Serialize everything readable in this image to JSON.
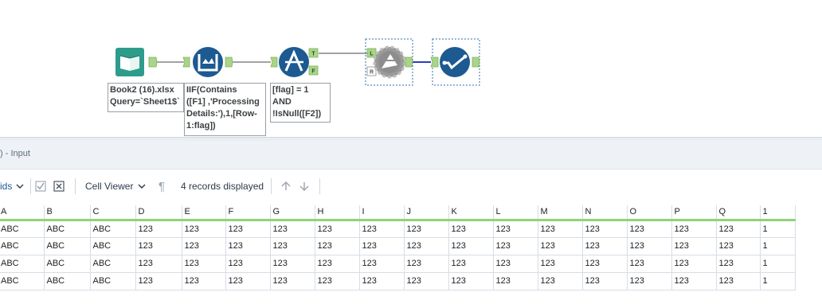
{
  "canvas": {
    "tools": [
      {
        "name": "input-data-tool",
        "annotation": "Book2 (16).xlsx\nQuery=`Sheet1$`"
      },
      {
        "name": "multi-row-formula-tool",
        "annotation": "IIF(Contains\n([F1] ,'Processing\nDetails:'),1,[Row-\n1:flag])"
      },
      {
        "name": "filter-tool",
        "annotation": "[flag] = 1\nAND\n!IsNull([F2])",
        "anchors": [
          "T",
          "F"
        ]
      },
      {
        "name": "dynamic-rename-tool",
        "anchors": [
          "L",
          "R"
        ]
      },
      {
        "name": "select-tool"
      }
    ]
  },
  "results": {
    "title": ") - Input",
    "toolbar": {
      "fields_label": "ids",
      "cell_viewer_label": "Cell Viewer",
      "records_label": "4 records displayed"
    },
    "columns": [
      "A",
      "B",
      "C",
      "D",
      "E",
      "F",
      "G",
      "H",
      "I",
      "J",
      "K",
      "L",
      "M",
      "N",
      "O",
      "P",
      "Q",
      "1"
    ],
    "rows": [
      [
        "ABC",
        "ABC",
        "ABC",
        "123",
        "123",
        "123",
        "123",
        "123",
        "123",
        "123",
        "123",
        "123",
        "123",
        "123",
        "123",
        "123",
        "123",
        "1"
      ],
      [
        "ABC",
        "ABC",
        "ABC",
        "123",
        "123",
        "123",
        "123",
        "123",
        "123",
        "123",
        "123",
        "123",
        "123",
        "123",
        "123",
        "123",
        "123",
        "1"
      ],
      [
        "ABC",
        "ABC",
        "ABC",
        "123",
        "123",
        "123",
        "123",
        "123",
        "123",
        "123",
        "123",
        "123",
        "123",
        "123",
        "123",
        "123",
        "123",
        "1"
      ],
      [
        "ABC",
        "ABC",
        "ABC",
        "123",
        "123",
        "123",
        "123",
        "123",
        "123",
        "123",
        "123",
        "123",
        "123",
        "123",
        "123",
        "123",
        "123",
        "1"
      ]
    ]
  },
  "colors": {
    "accent": "#1c5a91",
    "input_tool": "#2e9c8b",
    "connector": "#8fd27b"
  }
}
